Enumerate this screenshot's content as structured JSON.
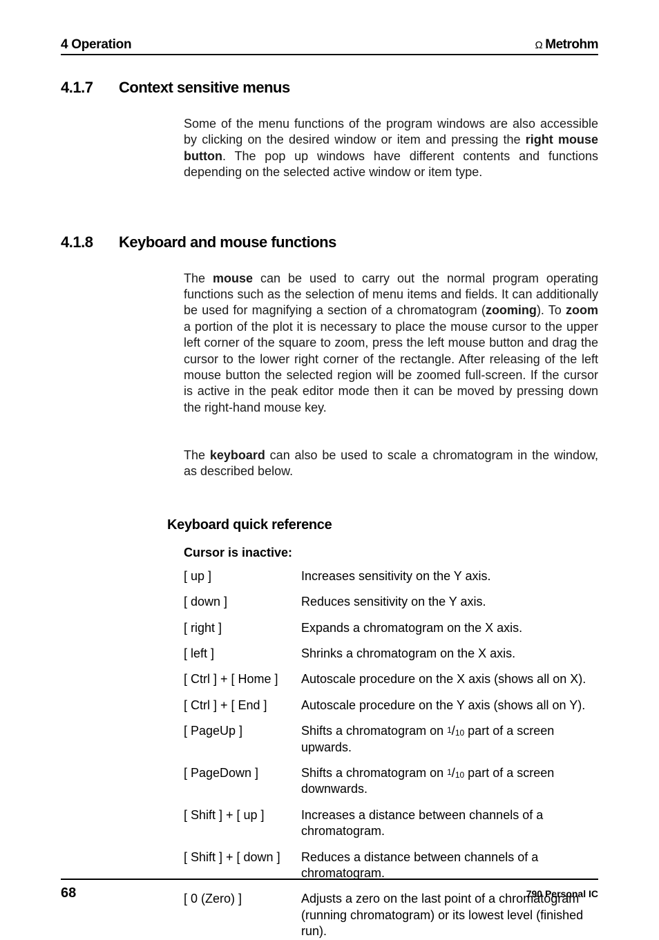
{
  "header": {
    "left": "4 Operation",
    "brand": "Metrohm"
  },
  "sections": {
    "s417": {
      "num": "4.1.7",
      "title": "Context sensitive menus",
      "para_pre": "Some of the menu functions of the program windows are also accessible by clicking on the desired window or item and pressing the ",
      "bold1": "right mouse button",
      "para_post": ". The pop up windows have different contents and functions depending on the selected active window or item type."
    },
    "s418": {
      "num": "4.1.8",
      "title": "Keyboard and mouse functions",
      "p1_a": "The ",
      "p1_b1": "mouse",
      "p1_b": " can be used to carry out the normal program operating functions such as the selection of menu items and fields. It can additionally be used for magnifying a section of a chromatogram (",
      "p1_b2": "zooming",
      "p1_c": "). To ",
      "p1_b3": "zoom",
      "p1_d": " a portion of the plot it is necessary to place the mouse cursor to the upper left corner of the square to zoom, press the left mouse button and drag the cursor to the lower right corner of the rectangle. After releasing of the left mouse button the selected region will be zoomed full-screen. If the cursor is active in the peak editor mode then it can be moved by pressing down the right-hand mouse key.",
      "p2_a": "The ",
      "p2_b1": "keyboard",
      "p2_b": " can also be used to scale a chromatogram in the window, as described below."
    },
    "quickref": {
      "heading": "Keyboard quick reference",
      "cursor_heading": "Cursor is inactive:",
      "rows": [
        {
          "key": "[ up ]",
          "desc": "Increases sensitivity on the Y axis."
        },
        {
          "key": "[ down ]",
          "desc": "Reduces sensitivity on the Y axis."
        },
        {
          "key": "[ right ]",
          "desc": "Expands a chromatogram on the X axis."
        },
        {
          "key": "[ left ]",
          "desc": "Shrinks a chromatogram on the X axis."
        },
        {
          "key": "[ Ctrl ] + [ Home ]",
          "desc": "Autoscale procedure on the X axis (shows all on X)."
        },
        {
          "key": "[ Ctrl ] + [ End ]",
          "desc": "Autoscale procedure on the Y axis (shows all on Y)."
        },
        {
          "key": "[ PageUp ]",
          "desc_pre": "Shifts a chromatogram on ",
          "frac_num": "1",
          "frac_den": "10",
          "desc_post": " part of a screen upwards."
        },
        {
          "key": "[ PageDown ]",
          "desc_pre": "Shifts a chromatogram on ",
          "frac_num": "1",
          "frac_den": "10",
          "desc_post": " part of a screen downwards."
        },
        {
          "key": "[ Shift ] + [ up ]",
          "desc": "Increases a distance between channels of a chromatogram."
        },
        {
          "key": "[ Shift ] + [ down ]",
          "desc": "Reduces a distance between channels of a chromatogram."
        },
        {
          "key": "[ 0 (Zero) ]",
          "desc": "Adjusts a zero on the last point of a chromatogram (running chromatogram) or its lowest level (finished run)."
        }
      ]
    }
  },
  "footer": {
    "pagenum": "68",
    "manual": "790 Personal IC"
  }
}
